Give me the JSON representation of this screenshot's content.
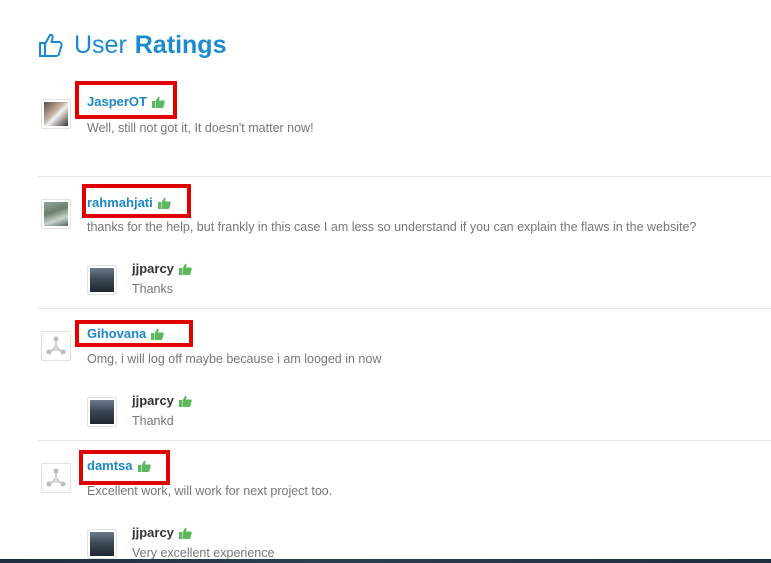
{
  "header": {
    "title_light": "User",
    "title_bold": "Ratings",
    "icon": "thumbs-up-icon"
  },
  "colors": {
    "accent": "#1b87c9",
    "like": "#5cb85c",
    "highlight": "#e00000"
  },
  "ratings": [
    {
      "user": "JasperOT",
      "comment": "Well, still not got it, It doesn't matter now!",
      "avatar": "photo"
    },
    {
      "user": "rahmahjati",
      "comment": "thanks for the help, but frankly in this case I am less so understand if you can explain the flaws in the website?",
      "avatar": "photo",
      "reply": {
        "user": "jjparcy",
        "comment": "Thanks"
      }
    },
    {
      "user": "Gihovana",
      "comment": "Omg, i will log off maybe because i am looged in now",
      "avatar": "default",
      "reply": {
        "user": "jjparcy",
        "comment": "Thankd"
      }
    },
    {
      "user": "damtsa",
      "comment": "Excellent work, will work for next project too.",
      "avatar": "default",
      "reply": {
        "user": "jjparcy",
        "comment": "Very excellent experience"
      }
    }
  ]
}
